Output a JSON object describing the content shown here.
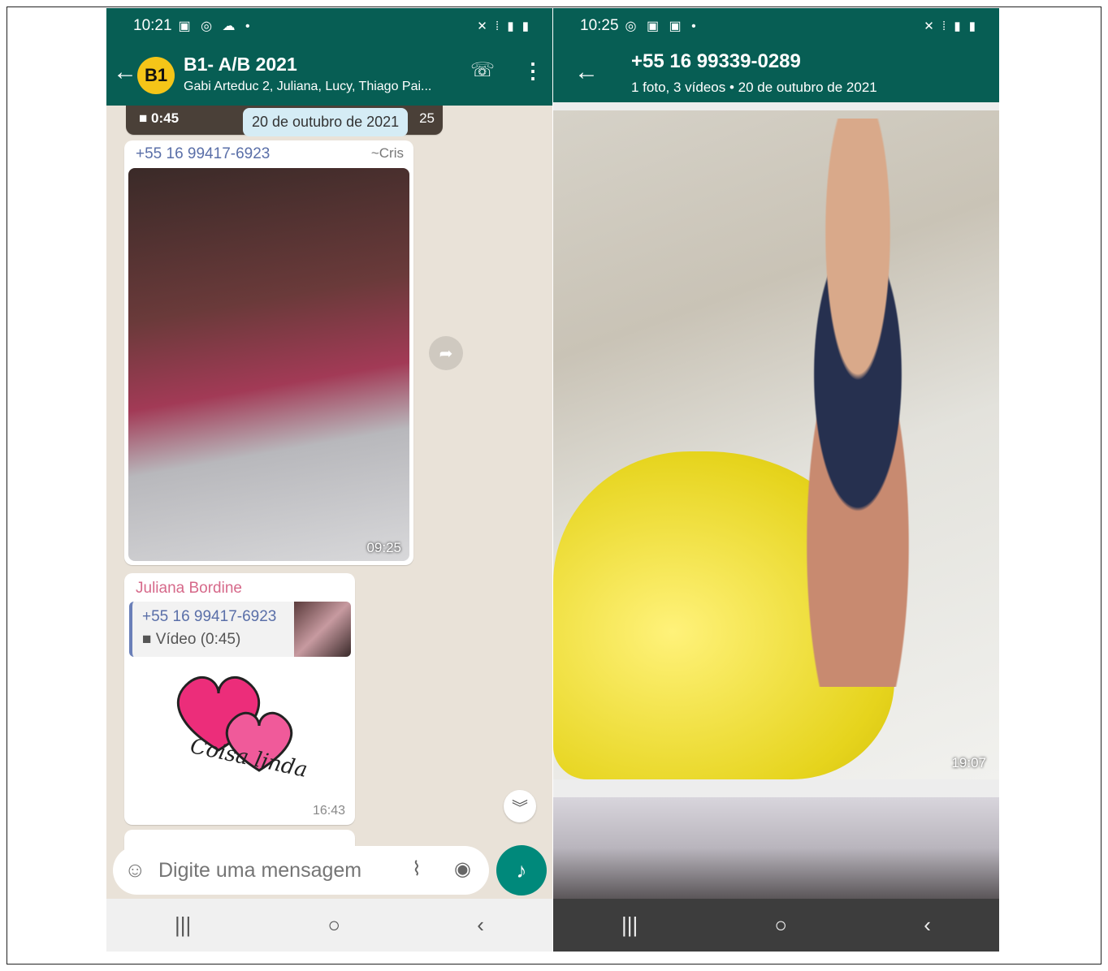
{
  "left": {
    "status": {
      "time": "10:21"
    },
    "header": {
      "avatar": "B1",
      "title": "B1- A/B 2021",
      "subtitle": "Gabi Arteduc 2, Juliana, Lucy, Thiago Pai..."
    },
    "previous_video": {
      "duration": "0:45",
      "time": "25"
    },
    "date_chip": "20 de outubro de 2021",
    "message1": {
      "sender": "+55 16 99417-6923",
      "alias": "~Cris",
      "time": "09:25"
    },
    "message2": {
      "sender": "Juliana Bordine",
      "quote_number": "+55 16 99417-6923",
      "quote_type": "Vídeo (0:45)",
      "sticker_text": "Coisa linda",
      "time": "16:43"
    },
    "input": {
      "placeholder": "Digite uma mensagem"
    }
  },
  "right": {
    "status": {
      "time": "10:25"
    },
    "header": {
      "title": "+55 16 99339-0289",
      "subtitle": "1 foto, 3 vídeos  •  20 de outubro de 2021"
    },
    "photo_time": "19:07"
  },
  "colors": {
    "header": "#075e54",
    "accent": "#00897b",
    "chat_bg": "#e9e2d8"
  }
}
